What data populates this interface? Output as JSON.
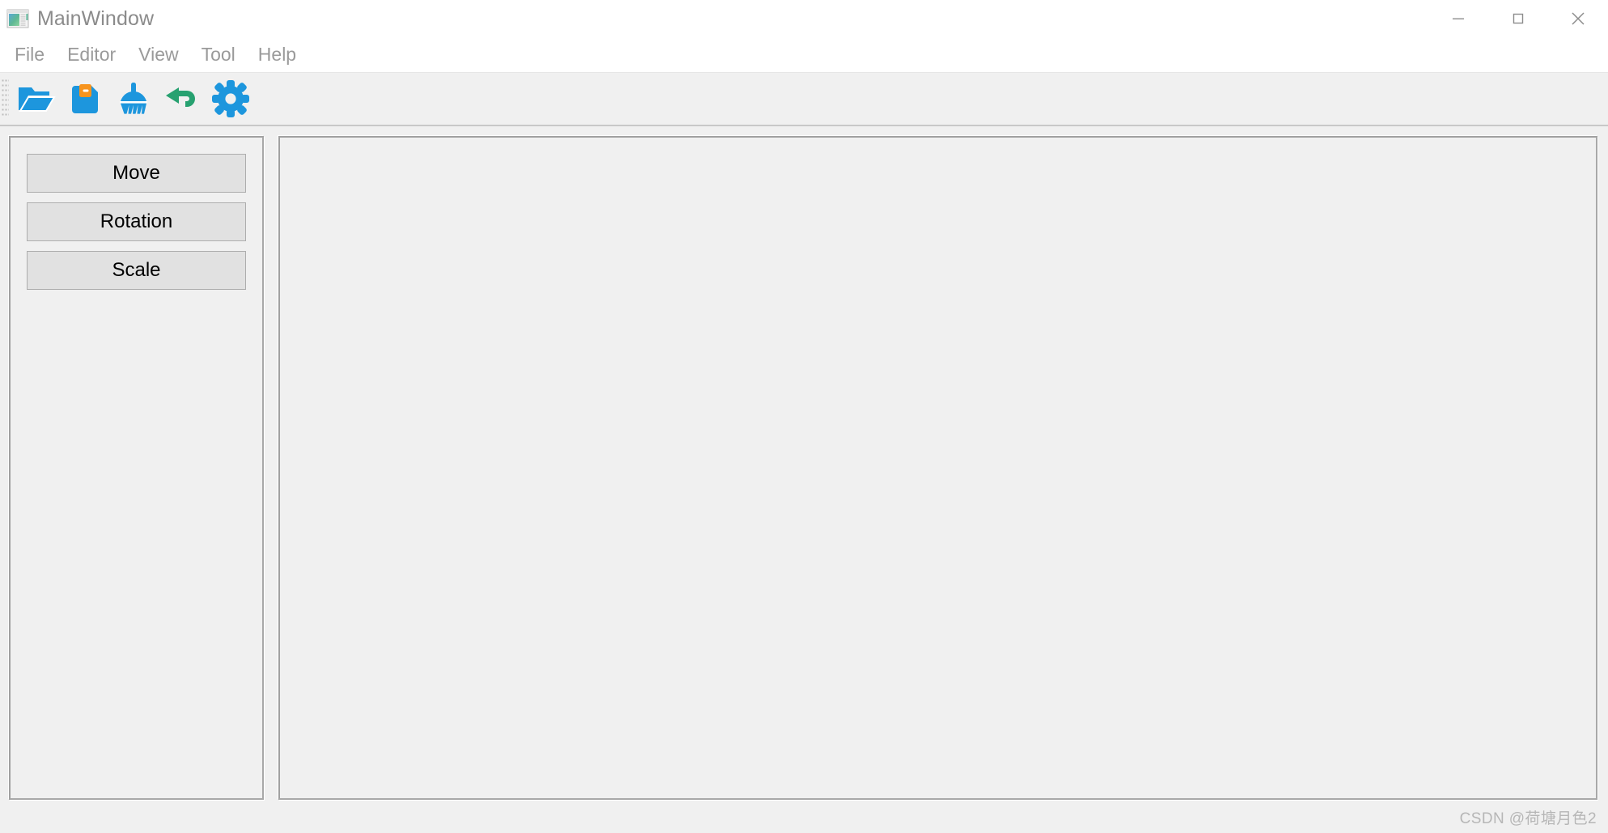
{
  "window": {
    "title": "MainWindow",
    "icon": "application-window-icon",
    "controls": [
      {
        "name": "minimize-button",
        "glyph": "minimize-icon"
      },
      {
        "name": "maximize-button",
        "glyph": "maximize-icon"
      },
      {
        "name": "close-button",
        "glyph": "close-icon"
      }
    ]
  },
  "menubar": {
    "items": [
      {
        "label": "File"
      },
      {
        "label": "Editor"
      },
      {
        "label": "View"
      },
      {
        "label": "Tool"
      },
      {
        "label": "Help"
      }
    ]
  },
  "toolbar": {
    "grip": "drag-handle",
    "buttons": [
      {
        "name": "open-folder-icon",
        "label": "Open"
      },
      {
        "name": "save-icon",
        "label": "Save"
      },
      {
        "name": "clean-broom-icon",
        "label": "Clean"
      },
      {
        "name": "undo-icon",
        "label": "Undo"
      },
      {
        "name": "settings-gear-icon",
        "label": "Settings"
      }
    ]
  },
  "sidebar": {
    "buttons": [
      {
        "label": "Move"
      },
      {
        "label": "Rotation"
      },
      {
        "label": "Scale"
      }
    ]
  },
  "canvas": {
    "content": ""
  },
  "watermark": {
    "text": "CSDN @荷塘月色2"
  },
  "colors": {
    "window_bg": "#f0f0f0",
    "titlebar_bg": "#ffffff",
    "title_text": "#8b8b8b",
    "menu_text": "#9a9a9a",
    "panel_border": "#a0a0a0",
    "button_face": "#e1e1e1",
    "button_border": "#adadad",
    "icon_blue": "#1d96dd",
    "icon_orange": "#f7941e",
    "icon_green": "#27a170",
    "watermark_text": "#b6b6b6"
  }
}
